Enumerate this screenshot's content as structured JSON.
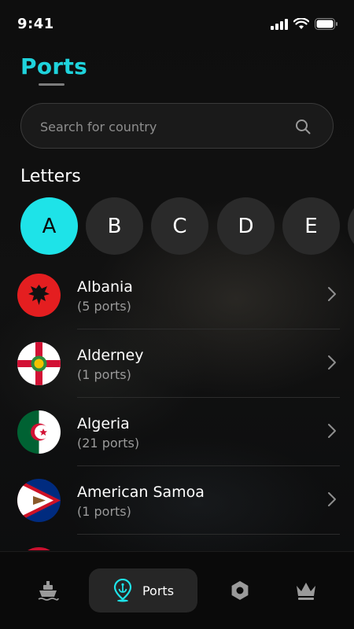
{
  "status": {
    "time": "9:41"
  },
  "header": {
    "title": "Ports"
  },
  "search": {
    "placeholder": "Search for country"
  },
  "letters": {
    "label": "Letters",
    "items": [
      "A",
      "B",
      "C",
      "D",
      "E"
    ],
    "selected": "A"
  },
  "countries": [
    {
      "name": "Albania",
      "ports": "(5 ports)"
    },
    {
      "name": "Alderney",
      "ports": "(1 ports)"
    },
    {
      "name": "Algeria",
      "ports": "(21 ports)"
    },
    {
      "name": "American Samoa",
      "ports": "(1 ports)"
    }
  ],
  "nav": {
    "items": [
      {
        "icon": "ship-icon",
        "label": ""
      },
      {
        "icon": "anchor-pin-icon",
        "label": "Ports"
      },
      {
        "icon": "hexagon-nut-icon",
        "label": ""
      },
      {
        "icon": "crown-icon",
        "label": ""
      }
    ],
    "active_label": "Ports"
  },
  "colors": {
    "accent": "#1ee3e8",
    "title": "#1fd3dc",
    "background": "#0b0b0b"
  }
}
